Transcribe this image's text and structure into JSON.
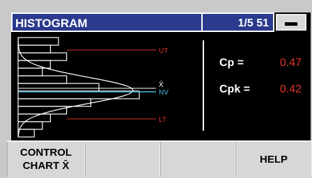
{
  "header": {
    "title": "HISTOGRAM",
    "sample_counter": "1/5 51",
    "key_icon": "minus-key-icon"
  },
  "chart_data": {
    "type": "bar",
    "orientation": "horizontal",
    "bins": [
      5,
      4,
      6,
      4,
      3,
      6,
      10,
      15,
      9,
      6,
      4,
      3,
      2
    ],
    "limit_labels": {
      "upper": "UT",
      "mean": "X̄",
      "nominal": "NV",
      "lower": "LT"
    },
    "curve": "normal-distribution",
    "colors": {
      "bars": "#ffffff",
      "limits": "#e0342a",
      "nominal": "#4ab8e0",
      "curve": "#ffffff"
    }
  },
  "stats": {
    "cp_label": "Cp  =",
    "cp_value": "0.47",
    "cpk_label": "Cpk =",
    "cpk_value": "0.42"
  },
  "softkeys": {
    "key1_line1": "CONTROL",
    "key1_line2": "CHART X̄",
    "key2": "",
    "key3": "",
    "key4": "HELP"
  }
}
